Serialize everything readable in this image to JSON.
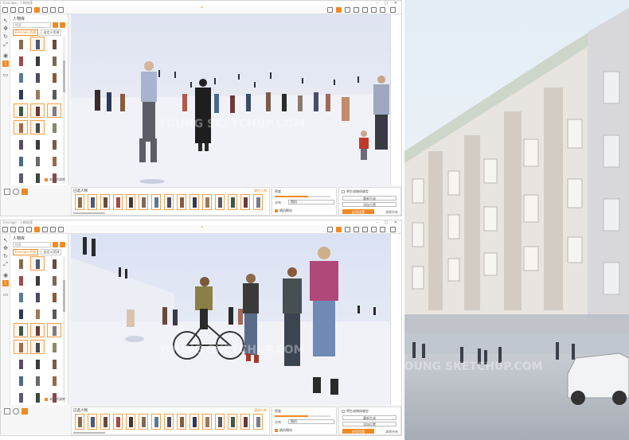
{
  "colors": {
    "accent": "#f08a24",
    "sky": "#dde4f2",
    "ground": "#f1f2f8"
  },
  "window": {
    "title": "Enscape - 人物快速",
    "title_short": "Enscape - 人物快速"
  },
  "toolbar_icons": [
    "file-icon",
    "project-icon",
    "undo-icon",
    "asset-icon",
    "home-icon",
    "people-icon",
    "layers-icon",
    "plus-icon",
    "settings-icon"
  ],
  "library": {
    "title": "人物库",
    "search_placeholder": "搜索",
    "tabs": [
      "Enscape 资源",
      "自定义资源"
    ],
    "random_checkbox": "来自资源库"
  },
  "selection": {
    "title": "已选人物",
    "link": "清空人物"
  },
  "params": {
    "density_label": "密度",
    "spread_label": "分布",
    "spread_value": "随机",
    "face_label": "朝向",
    "walk_checkbox": "随机朝向"
  },
  "actions": {
    "bind_checkbox": "将生成物体绑定",
    "place_button": "重新生成",
    "place_button_2": "添加位置",
    "generate_button": "应用设置",
    "reset_link": "清除所有"
  },
  "watermark": "YOUNG SKETCHUP.COM",
  "caret": "^"
}
